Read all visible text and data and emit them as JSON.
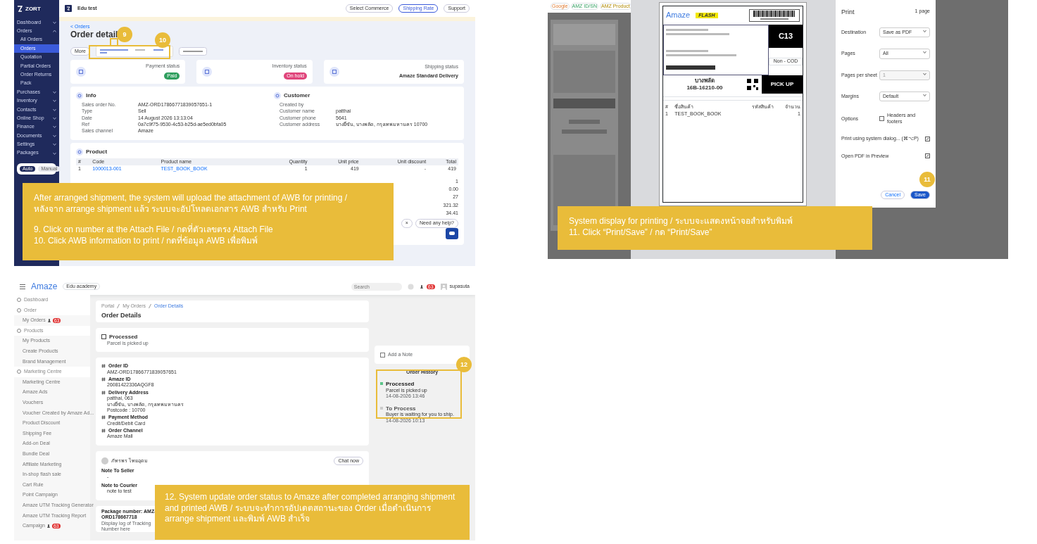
{
  "order_detail_screen": {
    "logo": "ZORT",
    "shop": "Edu test",
    "top_buttons": [
      "Select Commerce",
      "Shipping Rate",
      "Support"
    ],
    "sidebar": [
      {
        "label": "Dashboard",
        "expanded": false
      },
      {
        "label": "Orders",
        "expanded": true,
        "children": [
          {
            "label": "All Orders",
            "selected": false
          },
          {
            "label": "Orders",
            "selected": true
          },
          {
            "label": "Quotation",
            "selected": false
          },
          {
            "label": "Partial Orders",
            "selected": false
          },
          {
            "label": "Order Returns",
            "selected": false
          },
          {
            "label": "Pack",
            "selected": false
          }
        ]
      },
      {
        "label": "Purchases",
        "expanded": false
      },
      {
        "label": "Inventory",
        "expanded": false
      },
      {
        "label": "Contacts",
        "expanded": false
      },
      {
        "label": "Online Shop",
        "expanded": false
      },
      {
        "label": "Finance",
        "expanded": false
      },
      {
        "label": "Documents",
        "expanded": false
      },
      {
        "label": "Settings",
        "expanded": false
      },
      {
        "label": "Packages",
        "expanded": false
      }
    ],
    "mode_tabs": [
      {
        "label": "Auto",
        "selected": true
      },
      {
        "label": "Manual",
        "selected": false
      }
    ],
    "back_link": "< Orders",
    "title": "Order detail",
    "more_button": "More",
    "status_cards": [
      {
        "label": "Payment status",
        "value": "Paid",
        "kind": "badge",
        "color": "#2f9e5e"
      },
      {
        "label": "Inventory status",
        "value": "On hold",
        "kind": "badge",
        "color": "#e0457b"
      },
      {
        "label": "Shipping status",
        "value": "Amaze Standard Delivery",
        "kind": "text"
      }
    ],
    "info_title": "Info",
    "info_rows": [
      [
        "Sales order No.",
        "AMZ-ORD17866771839057651-1"
      ],
      [
        "Type",
        "Sell"
      ],
      [
        "Date",
        "14 August 2026 13:13:04"
      ],
      [
        "Ref",
        "0a7c9f75-9530-4c53-b25d-ae5ed0bfa05"
      ],
      [
        "Sales channel",
        "Amaze"
      ]
    ],
    "customer_title": "Customer",
    "customer_rows": [
      [
        "Created by"
      ],
      [
        "Customer name",
        "patthai"
      ],
      [
        "Customer phone",
        "5641"
      ],
      [
        "Customer address",
        "บางยี่ขัน, บางพลัด, กรุงเทพมหานคร 10700"
      ]
    ],
    "product_title": "Product",
    "product_columns": [
      "#",
      "Code",
      "Product name",
      "Quantity",
      "Unit price",
      "Unit discount",
      "Total"
    ],
    "product_rows": [
      [
        "1",
        "1000013-001",
        "TEST_BOOK_BOOK",
        "1",
        "419",
        "-",
        "419"
      ]
    ],
    "summary_values": [
      "1",
      "0.00",
      "27",
      "321.32",
      "34.41"
    ],
    "help_close": "×",
    "help_chip": "Need any help?",
    "step_badges": [
      "9",
      "10"
    ]
  },
  "print_screen": {
    "back_tags": [
      "Google",
      "AMZ ID/SN",
      "AMZ Product"
    ],
    "label": {
      "brands": [
        "Amaze",
        "FLASH"
      ],
      "sort_code": "C13",
      "cod": "Non - COD",
      "district": "บางพลัด",
      "route": "16B-16210-00",
      "pickup": "PICK UP",
      "item_columns": [
        "#",
        "ชื่อสินค้า",
        "รหัสสินค้า",
        "จำนวน"
      ],
      "items": [
        {
          "no": "1",
          "name": "TEST_BOOK_BOOK",
          "qty": "1"
        }
      ]
    },
    "dialog": {
      "title": "Print",
      "pages_info": "1 page",
      "settings": [
        {
          "label": "Destination",
          "value": "Save as PDF",
          "kind": "select",
          "disabled": false
        },
        {
          "label": "Pages",
          "value": "All",
          "kind": "select",
          "disabled": false
        },
        {
          "label": "Pages per sheet",
          "value": "1",
          "kind": "select",
          "disabled": true
        },
        {
          "label": "Margins",
          "value": "Default",
          "kind": "select",
          "disabled": false
        },
        {
          "label": "Options",
          "value": "Headers and footers",
          "kind": "checkbox",
          "checked": false
        }
      ],
      "links": [
        "Print using system dialog... (⌘⌥P)",
        "Open PDF in Preview"
      ],
      "cancel": "Cancel",
      "save": "Save"
    },
    "step_badges": [
      "11"
    ]
  },
  "amaze_screen": {
    "logo": "Amaze",
    "shop": "Edu academy",
    "search_placeholder": "Search",
    "notification_count": "63",
    "user": "supasuta",
    "sidebar": [
      {
        "label": "Dashboard",
        "kind": "section"
      },
      {
        "label": "Order",
        "kind": "section"
      },
      {
        "label": "My Orders",
        "kind": "item",
        "badge": "63"
      },
      {
        "label": "Products",
        "kind": "section"
      },
      {
        "label": "My Products",
        "kind": "item"
      },
      {
        "label": "Create Products",
        "kind": "item"
      },
      {
        "label": "Brand Management",
        "kind": "item"
      },
      {
        "label": "Marketing Centre",
        "kind": "section"
      },
      {
        "label": "Marketing Centre",
        "kind": "item"
      },
      {
        "label": "Amaze Ads",
        "kind": "item"
      },
      {
        "label": "Vouchers",
        "kind": "item"
      },
      {
        "label": "Voucher Created by Amaze Ad...",
        "kind": "item"
      },
      {
        "label": "Product Discount",
        "kind": "item"
      },
      {
        "label": "Shipping Fee",
        "kind": "item"
      },
      {
        "label": "Add-on Deal",
        "kind": "item"
      },
      {
        "label": "Bundle Deal",
        "kind": "item"
      },
      {
        "label": "Affiliate Marketing",
        "kind": "item"
      },
      {
        "label": "In-shop flash sale",
        "kind": "item"
      },
      {
        "label": "Cart Rule",
        "kind": "item"
      },
      {
        "label": "Point Campaign",
        "kind": "item"
      },
      {
        "label": "Amaze UTM Tracking Generator",
        "kind": "item"
      },
      {
        "label": "Amaze UTM Tracking Report",
        "kind": "item"
      },
      {
        "label": "Campaign",
        "kind": "item",
        "badge": "63"
      }
    ],
    "breadcrumb": [
      {
        "label": "Portal",
        "selected": false
      },
      {
        "label": "My Orders",
        "selected": false
      },
      {
        "label": "Order Details",
        "selected": true
      }
    ],
    "title": "Order Details",
    "status_title": "Processed",
    "status_text": "Parcel is picked up",
    "fields": [
      {
        "label": "Order ID",
        "lines": [
          "AMZ-ORD17866771839057651"
        ]
      },
      {
        "label": "Amaze ID",
        "lines": [
          "26081422336AQGF8"
        ]
      },
      {
        "label": "Delivery Address",
        "lines": [
          "patthai, 063",
          "บางยี่ขัน, บางพลัด, กรุงเทพมหานคร",
          "Postcode : 10700"
        ]
      },
      {
        "label": "Payment Method",
        "lines": [
          "Credit/Debit Card"
        ]
      },
      {
        "label": "Order Channel",
        "lines": [
          "Amaze Mall"
        ]
      }
    ],
    "buyer_name": "ภัทรพร ไทยอุดม",
    "chat_button": "Chat now",
    "notes": [
      {
        "label": "Note To Seller",
        "text": "-"
      },
      {
        "label": "Note to Courier",
        "text": "note to test"
      }
    ],
    "package_number": "Package number: AMZ-ORD178667718",
    "tracking_hint": "Display log of Tracking Number here",
    "add_note": "Add a Note",
    "history_title": "Order History",
    "history": [
      {
        "title": "Processed",
        "text": "Parcel is picked up",
        "time": "14-08-2026 13:46",
        "selected": true
      },
      {
        "title": "To Process",
        "text": "Buyer is waiting for you to ship.",
        "time": "14-08-2026 10:13",
        "selected": false
      }
    ],
    "step_badges": [
      "12"
    ]
  },
  "callouts": [
    {
      "lines": [
        "After arranged shipment, the system will upload the attachment of AWB for printing / หลังจาก arrange shipment แล้ว ระบบจะอัปโหลดเอกสาร AWB สำหรับ Print",
        "9. Click on number at the Attach File / กดที่ตัวเลขตรง Attach File",
        "10. Click AWB information to print / กดที่ข้อมูล AWB เพื่อพิมพ์"
      ]
    },
    {
      "lines": [
        "System display for printing / ระบบจะแสดงหน้าจอสำหรับพิมพ์",
        "11. Click “Print/Save” / กด “Print/Save”"
      ]
    },
    {
      "lines": [
        "12. System update order status to Amaze after completed arranging shipment and printed AWB / ระบบจะทำการอัปเดตสถานะของ Order เมื่อดำเนินการ arrange shipment และพิมพ์ AWB สำเร็จ"
      ]
    }
  ]
}
